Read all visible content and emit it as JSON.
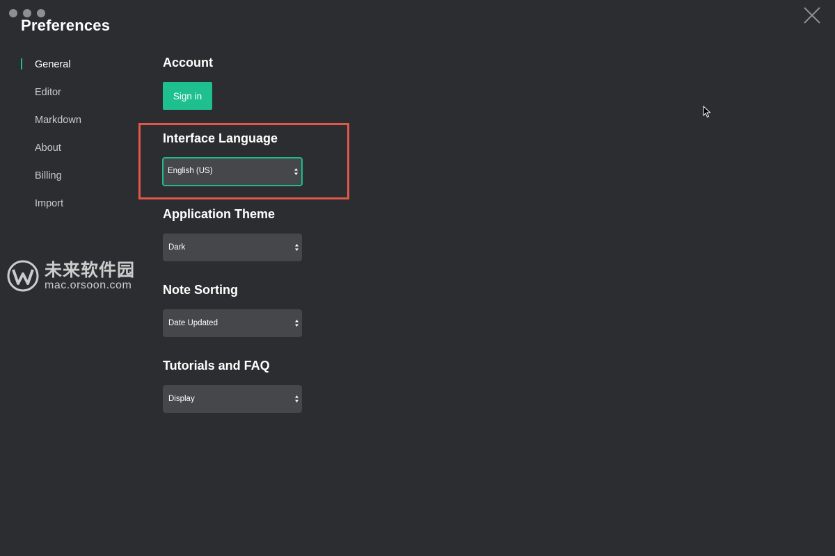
{
  "window": {
    "title": "Preferences"
  },
  "sidebar": {
    "items": [
      {
        "label": "General",
        "active": true
      },
      {
        "label": "Editor",
        "active": false
      },
      {
        "label": "Markdown",
        "active": false
      },
      {
        "label": "About",
        "active": false
      },
      {
        "label": "Billing",
        "active": false
      },
      {
        "label": "Import",
        "active": false
      }
    ]
  },
  "account": {
    "title": "Account",
    "sign_in_label": "Sign in"
  },
  "interface_language": {
    "title": "Interface Language",
    "value": "English (US)"
  },
  "application_theme": {
    "title": "Application Theme",
    "value": "Dark"
  },
  "note_sorting": {
    "title": "Note Sorting",
    "value": "Date Updated"
  },
  "tutorials": {
    "title": "Tutorials and FAQ",
    "value": "Display"
  },
  "watermark": {
    "name": "未来软件园",
    "url": "mac.orsoon.com"
  },
  "icons": {
    "close": "close-icon",
    "select_arrows": "select-arrows-icon",
    "cursor": "mouse-cursor-icon"
  },
  "colors": {
    "background": "#2c2d30",
    "accent": "#1fc08f",
    "select_background": "#46474b",
    "highlight": "#e3574a"
  }
}
